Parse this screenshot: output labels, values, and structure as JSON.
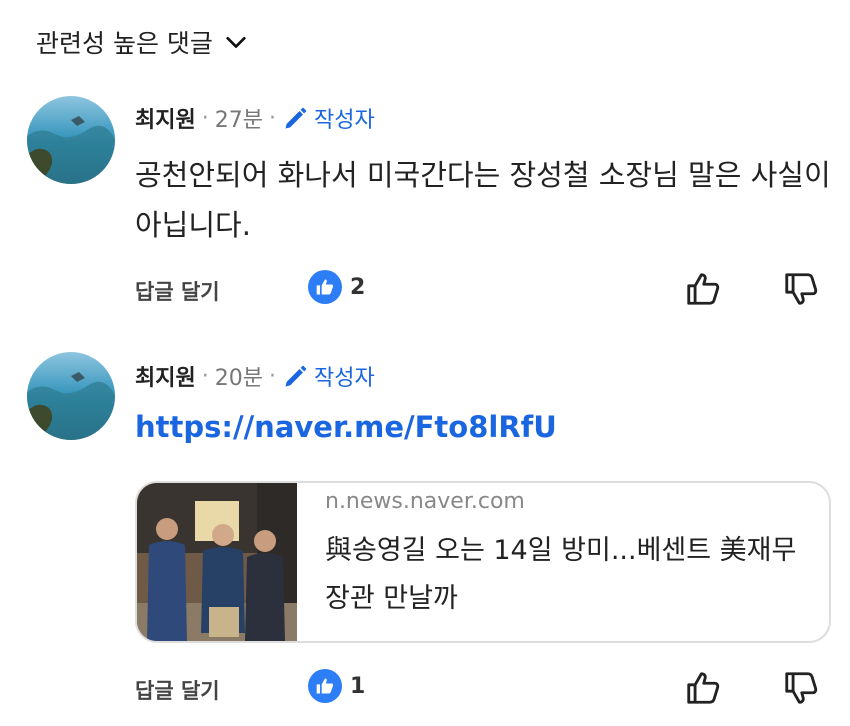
{
  "header": {
    "sort_label": "관련성 높은 댓글"
  },
  "comments": [
    {
      "author": "최지원",
      "time": "27분",
      "author_badge": "작성자",
      "text": "공천안되어 화나서 미국간다는 장성철 소장님 말은 사실이 아닙니다.",
      "reply_label": "답글 달기",
      "like_count": "2"
    },
    {
      "author": "최지원",
      "time": "20분",
      "author_badge": "작성자",
      "link": "https://naver.me/Fto8lRfU",
      "link_preview": {
        "domain": "n.news.naver.com",
        "title": "與송영길 오는 14일 방미...베센트 美재무장관 만날까"
      },
      "reply_label": "답글 달기",
      "like_count": "1"
    }
  ],
  "colors": {
    "accent": "#1a66e0",
    "like_badge": "#2d7df6"
  }
}
